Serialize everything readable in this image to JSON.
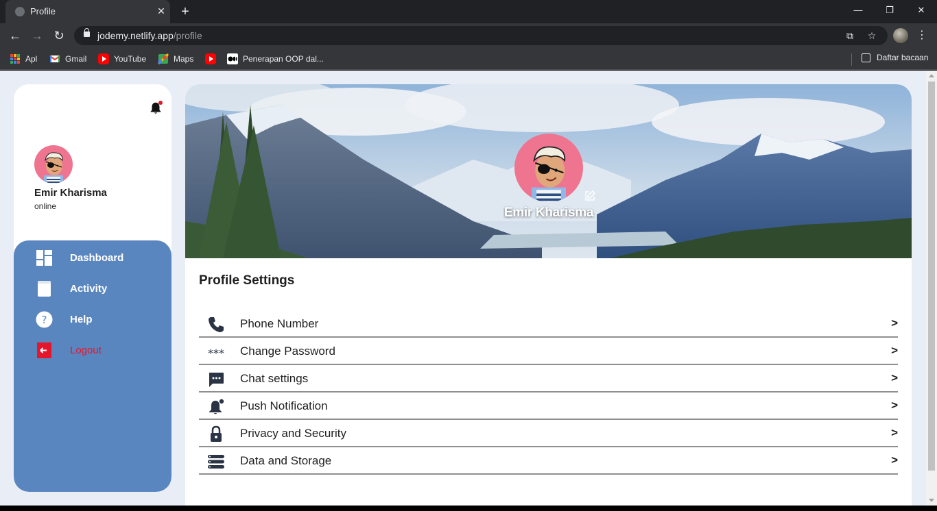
{
  "browser": {
    "tab_title": "Profile",
    "url_host": "jodemy.netlify.app",
    "url_path": "/profile",
    "bookmarks": [
      {
        "label": "Apl",
        "icon": "apps-grid-icon"
      },
      {
        "label": "Gmail",
        "icon": "gmail-icon"
      },
      {
        "label": "YouTube",
        "icon": "youtube-icon"
      },
      {
        "label": "Maps",
        "icon": "maps-icon"
      },
      {
        "label": "",
        "icon": "youtube-icon"
      },
      {
        "label": "Penerapan OOP dal...",
        "icon": "medium-icon"
      }
    ],
    "reading_list": "Daftar bacaan"
  },
  "sidebar": {
    "user_name": "Emir Kharisma",
    "status": "online",
    "nav": [
      {
        "label": "Dashboard",
        "icon": "dashboard-icon"
      },
      {
        "label": "Activity",
        "icon": "book-icon"
      },
      {
        "label": "Help",
        "icon": "help-icon"
      },
      {
        "label": "Logout",
        "icon": "logout-icon"
      }
    ]
  },
  "profile": {
    "banner_name": "Emir Kharisma",
    "settings_title": "Profile Settings",
    "settings": [
      {
        "label": "Phone Number",
        "icon": "phone-icon",
        "arrow": ">"
      },
      {
        "label": "Change Password",
        "icon": "password-icon",
        "arrow": ">"
      },
      {
        "label": "Chat settings",
        "icon": "chat-icon",
        "arrow": ">"
      },
      {
        "label": "Push Notification",
        "icon": "bell-icon",
        "arrow": ">"
      },
      {
        "label": "Privacy and Security",
        "icon": "lock-icon",
        "arrow": ">"
      },
      {
        "label": "Data and Storage",
        "icon": "storage-icon",
        "arrow": ">"
      }
    ]
  },
  "colors": {
    "sidebar_nav_bg": "#5a86c0",
    "logout_red": "#e3162c",
    "avatar_pink": "#ee7490",
    "page_bg": "#e8edf6"
  }
}
